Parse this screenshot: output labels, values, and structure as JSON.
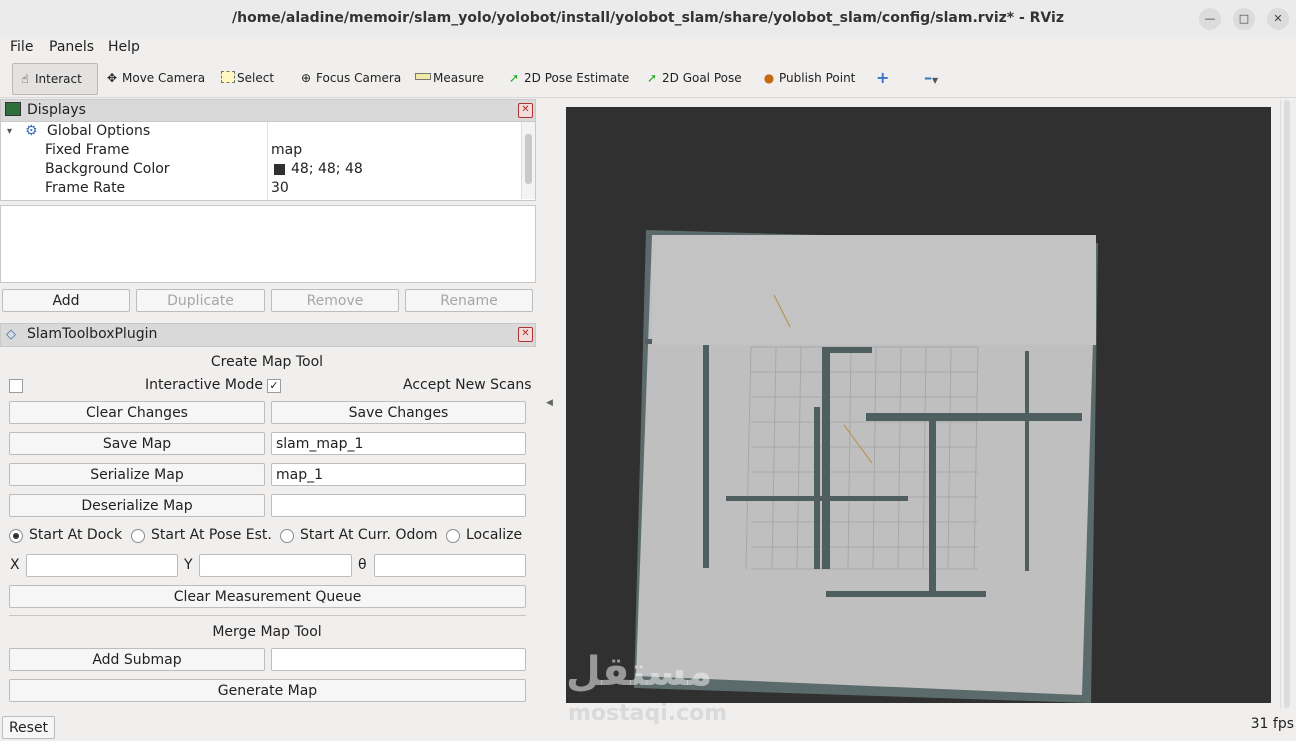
{
  "window": {
    "title": "/home/aladine/memoir/slam_yolo/yolobot/install/yolobot_slam/share/yolobot_slam/config/slam.rviz* - RViz"
  },
  "menu": {
    "file": "File",
    "panels": "Panels",
    "help": "Help"
  },
  "toolbar": {
    "interact": "Interact",
    "move_camera": "Move Camera",
    "select": "Select",
    "focus_camera": "Focus Camera",
    "measure": "Measure",
    "pose_estimate": "2D Pose Estimate",
    "goal_pose": "2D Goal Pose",
    "publish_point": "Publish Point"
  },
  "displays": {
    "title": "Displays",
    "global_options": "Global Options",
    "rows": [
      {
        "name": "Fixed Frame",
        "value": "map"
      },
      {
        "name": "Background Color",
        "value": "48; 48; 48"
      },
      {
        "name": "Frame Rate",
        "value": "30"
      }
    ],
    "bg_swatch": "#303030",
    "buttons": {
      "add": "Add",
      "duplicate": "Duplicate",
      "remove": "Remove",
      "rename": "Rename"
    }
  },
  "slam": {
    "title": "SlamToolboxPlugin",
    "create_title": "Create Map Tool",
    "interactive_mode": "Interactive Mode",
    "accept_scans": "Accept New Scans",
    "clear_changes": "Clear Changes",
    "save_changes": "Save Changes",
    "save_map": "Save Map",
    "save_map_value": "slam_map_1",
    "serialize_map": "Serialize Map",
    "serialize_value": "map_1",
    "deserialize_map": "Deserialize Map",
    "deserialize_value": "",
    "start_dock": "Start At Dock",
    "start_pose": "Start At Pose Est.",
    "start_odom": "Start At Curr. Odom",
    "localize": "Localize",
    "x_label": "X",
    "y_label": "Y",
    "theta_label": "θ",
    "clear_queue": "Clear Measurement Queue",
    "merge_title": "Merge Map Tool",
    "add_submap": "Add Submap",
    "add_submap_value": "",
    "generate_map": "Generate Map"
  },
  "footer": {
    "reset": "Reset",
    "fps": "31 fps"
  },
  "watermark": {
    "arabic": "مستقل",
    "latin": "mostaqi.com"
  }
}
